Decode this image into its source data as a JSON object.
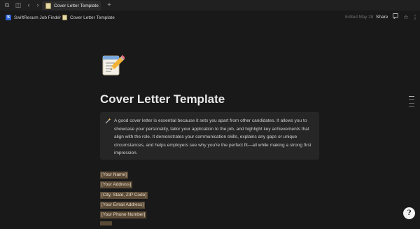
{
  "titlebar": {
    "tab_title": "Cover Letter Template",
    "icons": [
      "window-icon",
      "sidebar-icon",
      "back-icon",
      "forward-icon",
      "plus-icon"
    ]
  },
  "header": {
    "breadcrumb": [
      {
        "label": "SwiftResum Job Finder",
        "icon": "S"
      },
      {
        "label": "Cover Letter Template",
        "icon": "document"
      }
    ],
    "separator": "/",
    "edited": "Edited May 28",
    "share_label": "Share"
  },
  "page": {
    "icon": "memo-emoji",
    "title": "Cover Letter Template",
    "callout_icon": "magic-wand-sparkle-icon",
    "callout_text": "A good cover letter is essential because it sets you apart from other candidates. It allows you to showcase your personality, tailor your application to the job, and highlight key achievements that align with the role. It demonstrates your communication skills, explains any gaps or unique circumstances, and helps employers see why you're the perfect fit—all while making a strong first impression.",
    "fields": [
      "[Your Name]",
      "[Your Address]",
      "[City, State, ZIP Code]",
      "[Your Email Address]",
      "[Your Phone Number]"
    ]
  },
  "help_label": "?",
  "colors": {
    "background": "#191919",
    "highlight": "#5b4a36",
    "callout_bg": "#262626"
  }
}
